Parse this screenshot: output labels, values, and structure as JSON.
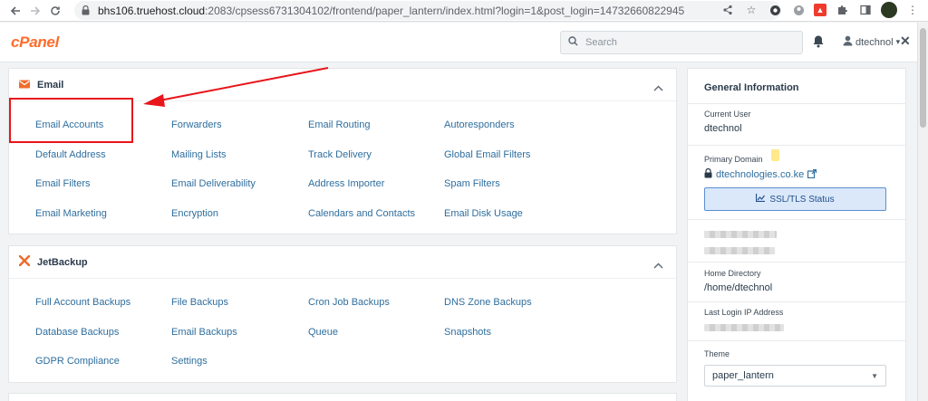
{
  "browser": {
    "url_host": "bhs106.truehost.cloud",
    "url_rest": ":2083/cpsess6731304102/frontend/paper_lantern/index.html?login=1&post_login=14732660822945",
    "icons": [
      "back-icon",
      "forward-icon",
      "reload-icon",
      "lock-icon",
      "share-icon",
      "star-icon",
      "extension-icon",
      "puzzle-icon",
      "sidebar-icon",
      "profile-icon",
      "menu-icon"
    ]
  },
  "header": {
    "logo": "cPanel",
    "search_placeholder": "Search",
    "username": "dtechnol",
    "user_caret": "▾",
    "close": "✕"
  },
  "email_panel": {
    "title": "Email",
    "items": [
      "Email Accounts",
      "Forwarders",
      "Email Routing",
      "Autoresponders",
      "Default Address",
      "Mailing Lists",
      "Track Delivery",
      "Global Email Filters",
      "Email Filters",
      "Email Deliverability",
      "Address Importer",
      "Spam Filters",
      "Email Marketing",
      "Encryption",
      "Calendars and Contacts",
      "Email Disk Usage"
    ]
  },
  "jetbackup_panel": {
    "title": "JetBackup",
    "items": [
      "Full Account Backups",
      "File Backups",
      "Cron Job Backups",
      "DNS Zone Backups",
      "Database Backups",
      "Email Backups",
      "Queue",
      "Snapshots",
      "GDPR Compliance",
      "Settings"
    ]
  },
  "general_info": {
    "title": "General Information",
    "current_user_label": "Current User",
    "current_user": "dtechnol",
    "primary_domain_label": "Primary Domain",
    "primary_domain": "dtechnologies.co.ke",
    "ssl_button": "SSL/TLS Status",
    "home_dir_label": "Home Directory",
    "home_dir": "/home/dtechnol",
    "last_ip_label": "Last Login IP Address",
    "theme_label": "Theme",
    "theme_value": "paper_lantern"
  },
  "colors": {
    "accent": "#ff6c2c",
    "link": "#2e6e9e",
    "annotation": "#e8151a"
  }
}
